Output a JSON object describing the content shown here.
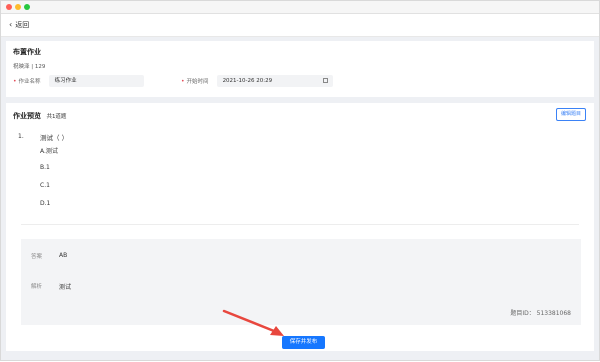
{
  "topbar": {
    "back_label": "返回"
  },
  "assignment": {
    "title": "布置作业",
    "class_info": "祝映泽 | 129",
    "name_label": "作业名称",
    "name_value": "练习作业",
    "start_label": "开始时间",
    "start_value": "2021-10-26 20:29"
  },
  "preview": {
    "title": "作业预览",
    "count": "共1道题",
    "edit_label": "编辑题目",
    "question": {
      "number": "1.",
      "text": "测试（  ）",
      "options": [
        "A.测试",
        "B.1",
        "C.1",
        "D.1"
      ]
    },
    "answer_label": "答案",
    "answer_value": "AB",
    "analysis_label": "解析",
    "analysis_value": "测试",
    "question_id": "题目ID：  513381068"
  },
  "footer": {
    "save_label": "保存并发布"
  },
  "colors": {
    "primary": "#1677ff",
    "required": "#e34d59",
    "arrow": "#e8473e"
  }
}
